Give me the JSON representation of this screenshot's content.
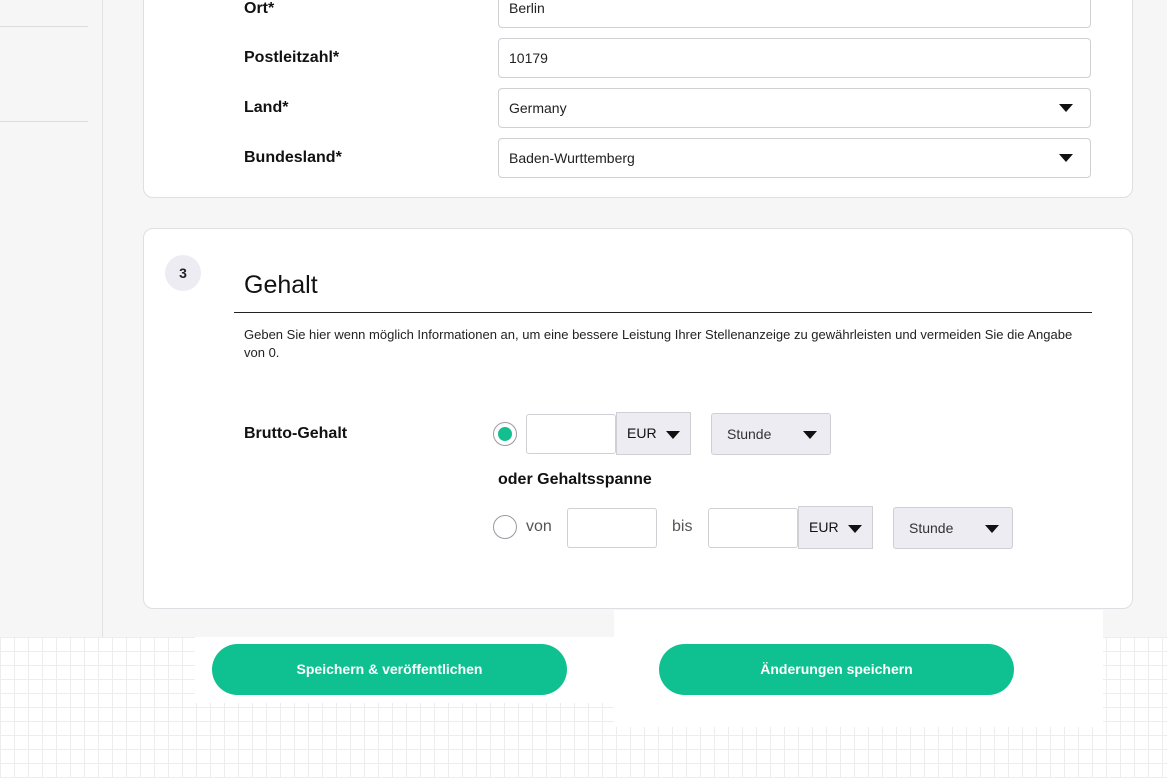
{
  "address": {
    "city": {
      "label": "Ort*",
      "value": "Berlin"
    },
    "postal_code": {
      "label": "Postleitzahl*",
      "value": "10179"
    },
    "country": {
      "label": "Land*",
      "value": "Germany"
    },
    "state": {
      "label": "Bundesland*",
      "value": "Baden-Wurttemberg"
    }
  },
  "salary": {
    "step_number": "3",
    "title": "Gehalt",
    "info": "Geben Sie hier wenn möglich Informationen an, um eine bessere Leistung Ihrer Stellenanzeige zu gewährleisten und vermeiden Sie die Angabe von 0.",
    "gross_label": "Brutto-Gehalt",
    "fixed": {
      "selected": true,
      "amount": "",
      "currency": "EUR",
      "period": "Stunde"
    },
    "range_heading": "oder Gehaltsspanne",
    "range": {
      "selected": false,
      "from_label": "von",
      "to_label": "bis",
      "from": "",
      "to": "",
      "currency": "EUR",
      "period": "Stunde"
    }
  },
  "actions": {
    "publish_label": "Speichern & veröffentlichen",
    "save_label": "Änderungen speichern"
  },
  "colors": {
    "accent": "#0fc191",
    "select_bg": "#ececf2"
  }
}
